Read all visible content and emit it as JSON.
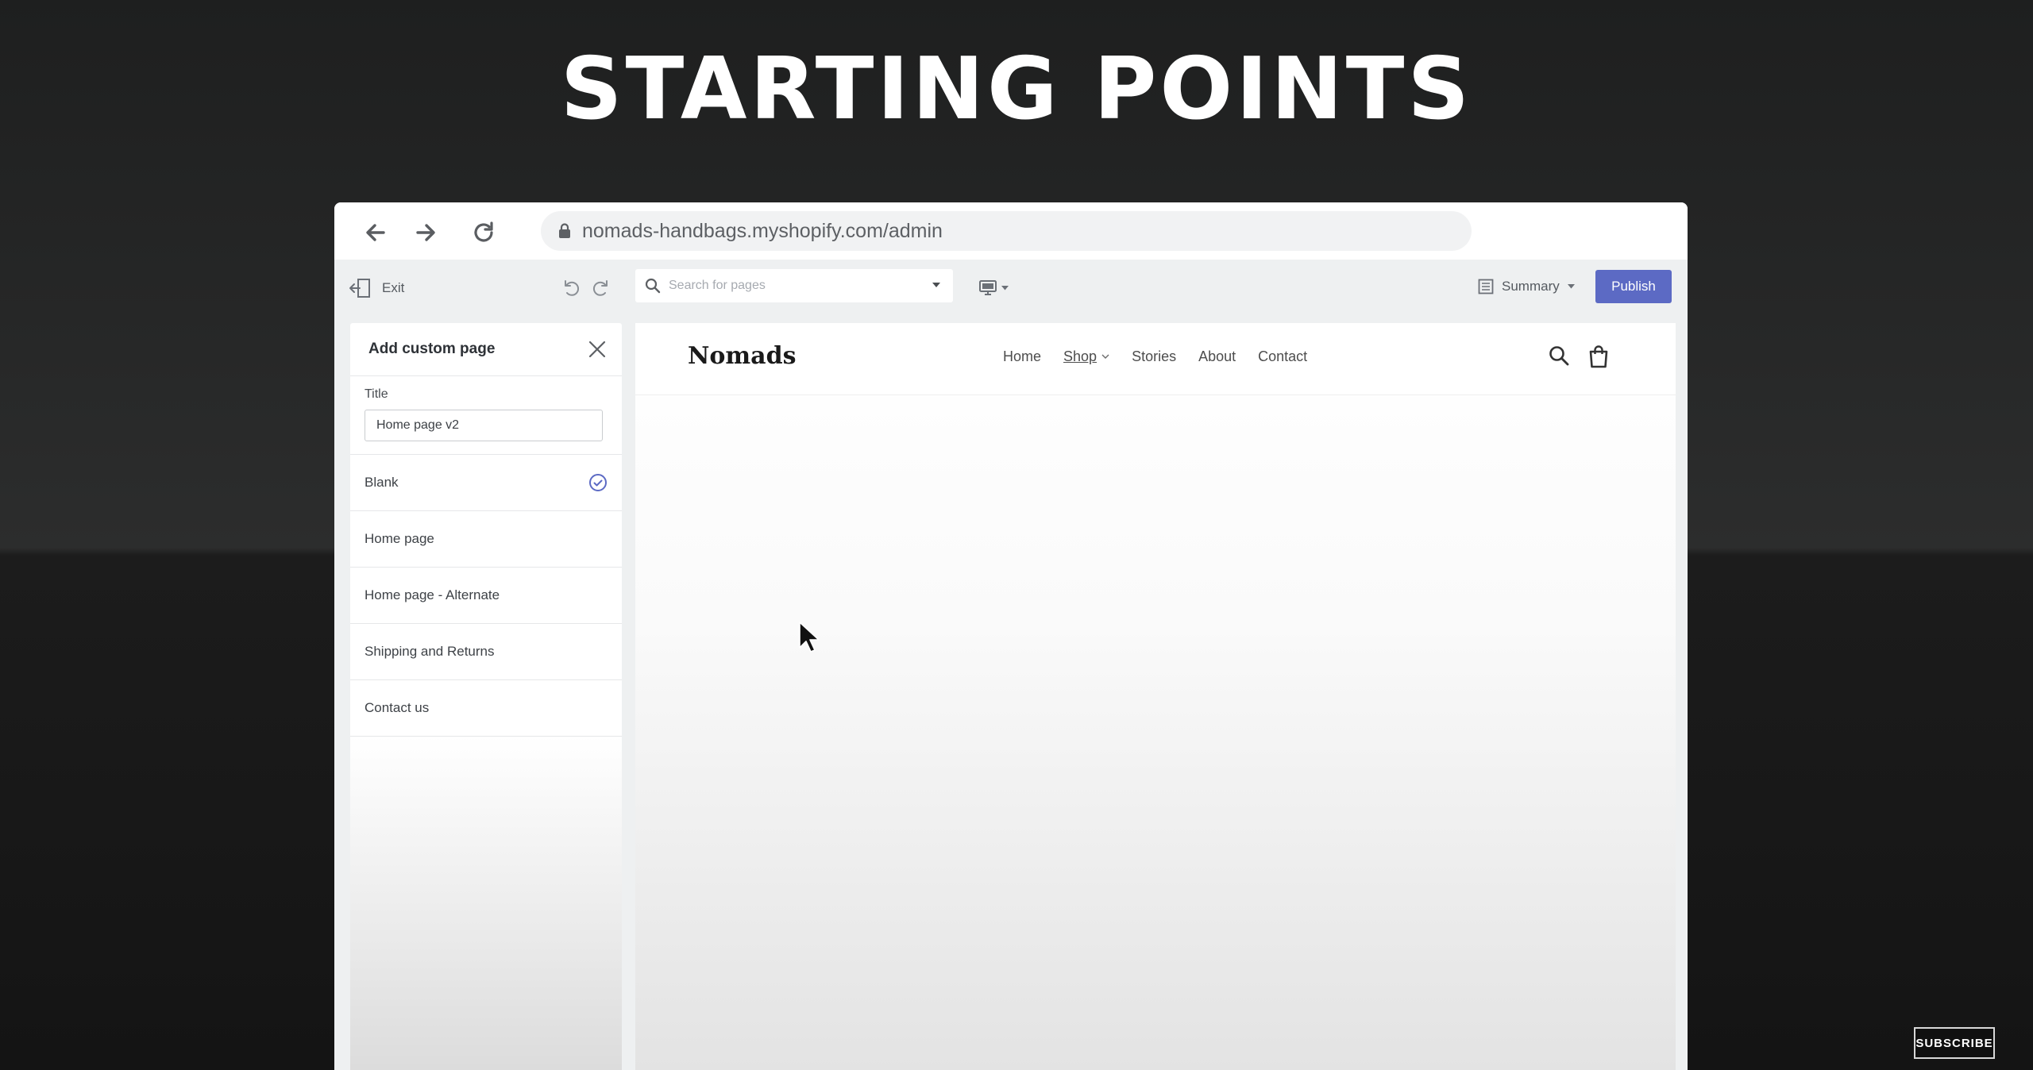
{
  "headline": "STARTING POINTS",
  "browser": {
    "url": "nomads-handbags.myshopify.com/admin"
  },
  "editor": {
    "exit_label": "Exit",
    "search_placeholder": "Search for pages",
    "summary_label": "Summary",
    "publish_label": "Publish"
  },
  "panel": {
    "title": "Add custom page",
    "field_label": "Title",
    "field_value": "Home page v2",
    "templates": [
      {
        "label": "Blank",
        "selected": true
      },
      {
        "label": "Home page",
        "selected": false
      },
      {
        "label": "Home page - Alternate",
        "selected": false
      },
      {
        "label": "Shipping and Returns",
        "selected": false
      },
      {
        "label": "Contact us",
        "selected": false
      }
    ]
  },
  "store": {
    "logo": "Nomads",
    "nav": [
      "Home",
      "Shop",
      "Stories",
      "About",
      "Contact"
    ]
  },
  "overlay": {
    "subscribe": "SUBSCRIBE"
  },
  "colors": {
    "publish": "#5c6ac4",
    "background": "#262727"
  },
  "icons": [
    "back-arrow-icon",
    "forward-arrow-icon",
    "reload-icon",
    "lock-icon",
    "exit-icon",
    "undo-icon",
    "redo-icon",
    "search-icon",
    "desktop-icon",
    "summary-icon",
    "close-icon",
    "check-circle-icon",
    "cart-bag-icon",
    "cursor-icon"
  ]
}
